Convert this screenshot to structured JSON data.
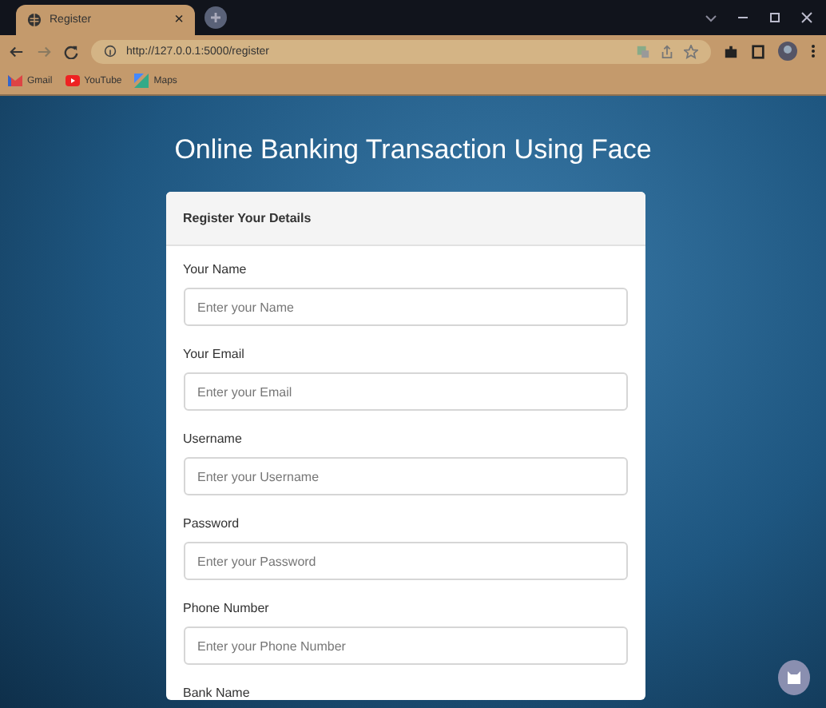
{
  "browser": {
    "tabs": [
      {
        "title": "Register",
        "close": "×",
        "selected": true
      }
    ],
    "url": "http://127.0.0.1:5000/register",
    "bookmarks": [
      {
        "kind": "gmail",
        "label": "Gmail"
      },
      {
        "kind": "youtube",
        "label": "YouTube"
      },
      {
        "kind": "maps",
        "label": "Maps"
      }
    ]
  },
  "page": {
    "title": "Online Banking Transaction Using Face",
    "card_header": "Register Your Details",
    "fields": [
      {
        "label": "Your Name",
        "placeholder": "Enter your Name"
      },
      {
        "label": "Your Email",
        "placeholder": "Enter your Email"
      },
      {
        "label": "Username",
        "placeholder": "Enter your Username"
      },
      {
        "label": "Password",
        "placeholder": "Enter your Password"
      },
      {
        "label": "Phone Number",
        "placeholder": "Enter your Phone Number"
      },
      {
        "label": "Bank Name"
      }
    ]
  }
}
